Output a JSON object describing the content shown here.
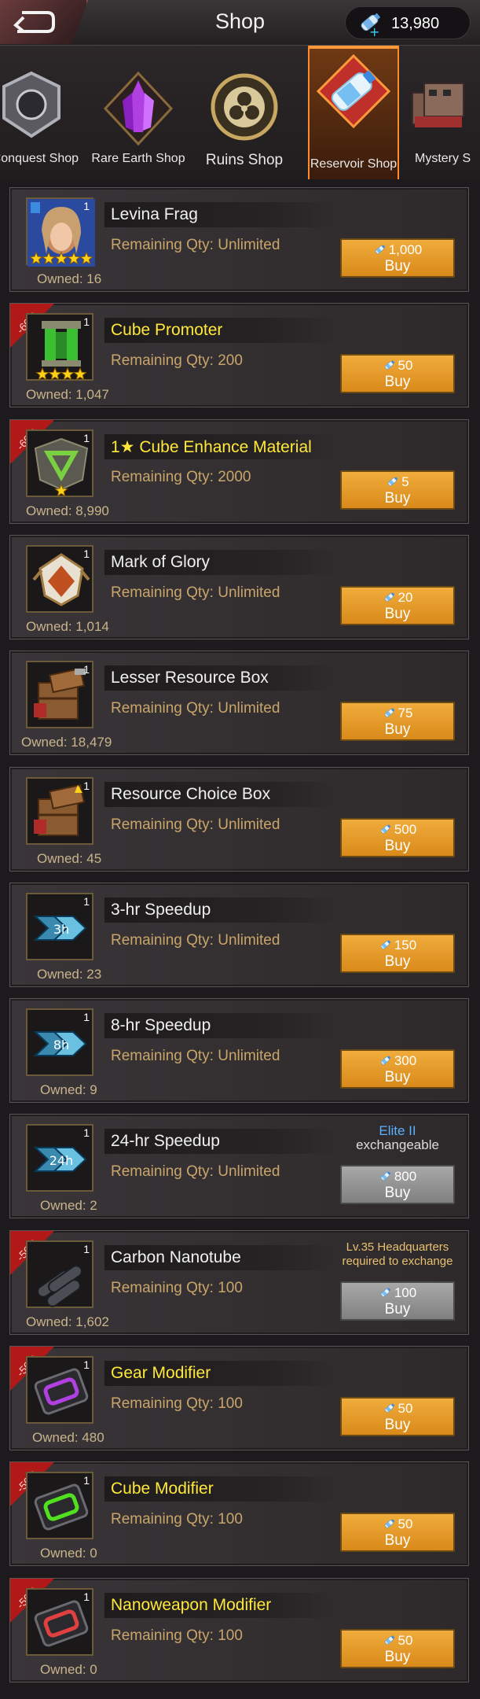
{
  "header": {
    "title": "Shop",
    "currency_amount": "13,980",
    "currency_icon": "water-bottle-icon"
  },
  "tabs": [
    {
      "label": "r Conquest Shop",
      "icon": "conquest-shield-icon",
      "active": false
    },
    {
      "label": "Rare Earth Shop",
      "icon": "purple-crystal-icon",
      "active": false
    },
    {
      "label": "Ruins Shop",
      "icon": "biohazard-emblem-icon",
      "active": false
    },
    {
      "label": "Reservoir Shop",
      "icon": "water-bottle-icon",
      "active": true
    },
    {
      "label": "Mystery S",
      "icon": "mystery-buildings-icon",
      "active": false
    }
  ],
  "items": [
    {
      "name": "Levina Frag",
      "remaining": "Remaining Qty: Unlimited",
      "owned": "Owned: 16",
      "price": "1,000",
      "buy": "Buy",
      "qty": "1",
      "discount": "",
      "gold_name": false,
      "icon": "levina-portrait-icon",
      "stars": 5
    },
    {
      "name": "Cube Promoter",
      "remaining": "Remaining Qty: 200",
      "owned": "Owned: 1,047",
      "price": "50",
      "buy": "Buy",
      "qty": "1",
      "discount": "-60%",
      "gold_name": true,
      "icon": "cube-promoter-icon",
      "stars": 4
    },
    {
      "name": "1★ Cube Enhance Material",
      "remaining": "Remaining Qty: 2000",
      "owned": "Owned: 8,990",
      "price": "5",
      "buy": "Buy",
      "qty": "1",
      "discount": "-60%",
      "gold_name": true,
      "icon": "cube-enhance-icon",
      "stars": 1
    },
    {
      "name": "Mark of Glory",
      "remaining": "Remaining Qty: Unlimited",
      "owned": "Owned: 1,014",
      "price": "20",
      "buy": "Buy",
      "qty": "1",
      "discount": "",
      "gold_name": false,
      "icon": "glory-medal-icon",
      "stars": 0
    },
    {
      "name": "Lesser Resource Box",
      "remaining": "Remaining Qty: Unlimited",
      "owned": "Owned: 18,479",
      "price": "75",
      "buy": "Buy",
      "qty": "1",
      "discount": "",
      "gold_name": false,
      "icon": "resource-box-icon",
      "stars": 0
    },
    {
      "name": "Resource Choice Box",
      "remaining": "Remaining Qty: Unlimited",
      "owned": "Owned: 45",
      "price": "500",
      "buy": "Buy",
      "qty": "1",
      "discount": "",
      "gold_name": false,
      "icon": "resource-choice-box-icon",
      "stars": 0
    },
    {
      "name": "3-hr Speedup",
      "remaining": "Remaining Qty: Unlimited",
      "owned": "Owned: 23",
      "price": "150",
      "buy": "Buy",
      "qty": "1",
      "discount": "",
      "gold_name": false,
      "icon": "speedup-icon",
      "speed": "3h"
    },
    {
      "name": "8-hr Speedup",
      "remaining": "Remaining Qty: Unlimited",
      "owned": "Owned: 9",
      "price": "300",
      "buy": "Buy",
      "qty": "1",
      "discount": "",
      "gold_name": false,
      "icon": "speedup-icon",
      "speed": "8h"
    },
    {
      "name": "24-hr Speedup",
      "remaining": "Remaining Qty: Unlimited",
      "owned": "Owned: 2",
      "price": "800",
      "buy": "Buy",
      "qty": "1",
      "discount": "",
      "gold_name": false,
      "icon": "speedup-icon",
      "speed": "24h",
      "disabled": true,
      "note1": "Elite II",
      "note2": "exchangeable",
      "note_type": "elite"
    },
    {
      "name": "Carbon Nanotube",
      "remaining": "Remaining Qty: 100",
      "owned": "Owned: 1,602",
      "price": "100",
      "buy": "Buy",
      "qty": "1",
      "discount": "-50%",
      "gold_name": false,
      "icon": "carbon-nanotube-icon",
      "disabled": true,
      "note1": "Lv.35 Headquarters",
      "note2": "required to exchange",
      "note_type": "req"
    },
    {
      "name": "Gear Modifier",
      "remaining": "Remaining Qty: 100",
      "owned": "Owned: 480",
      "price": "50",
      "buy": "Buy",
      "qty": "1",
      "discount": "-50%",
      "gold_name": true,
      "icon": "gear-modifier-icon",
      "chip_color": "#b040e0"
    },
    {
      "name": "Cube Modifier",
      "remaining": "Remaining Qty: 100",
      "owned": "Owned: 0",
      "price": "50",
      "buy": "Buy",
      "qty": "1",
      "discount": "-50%",
      "gold_name": true,
      "icon": "cube-modifier-icon",
      "chip_color": "#50e020"
    },
    {
      "name": "Nanoweapon Modifier",
      "remaining": "Remaining Qty: 100",
      "owned": "Owned: 0",
      "price": "50",
      "buy": "Buy",
      "qty": "1",
      "discount": "-50%",
      "gold_name": true,
      "icon": "nanoweapon-modifier-icon",
      "chip_color": "#e04040"
    }
  ]
}
